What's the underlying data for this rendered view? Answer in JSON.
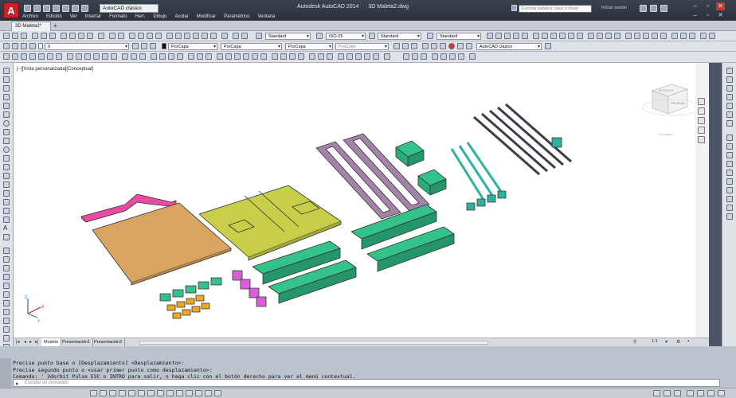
{
  "app": {
    "title": "Autodesk AutoCAD 2014",
    "document": "3D Maleta2.dwg",
    "logo": "A",
    "workspace": "AutoCAD clásico"
  },
  "search": {
    "placeholder": "Escriba palabra clave o frase"
  },
  "login": {
    "label": "Iniciar sesión"
  },
  "menu": [
    "Archivo",
    "Edición",
    "Ver",
    "Insertar",
    "Formato",
    "Herr.",
    "Dibujo",
    "Acotar",
    "Modificar",
    "Paramétrico",
    "Ventana"
  ],
  "tabs": {
    "document_tab": "3D Maleta2*"
  },
  "toolbar1": {
    "text_style": "Standard",
    "dim_style": "ISO-25",
    "table_style": "Standard",
    "mleader_style": "Standard"
  },
  "toolbar2": {
    "layer": "0",
    "color": "PorCapa",
    "linetype": "PorCapa",
    "lineweight": "PorCapa",
    "plotstyle": "PorColor",
    "workspace": "AutoCAD clásico"
  },
  "viewport": {
    "label": "[−][Vista personalizada][Conceptual]",
    "viewcube_face": "FRONTAL",
    "viewcube_top": "SUPERIOR",
    "wcs_label": "S-nombre"
  },
  "layout_tabs": [
    "Modelo",
    "Presentación1",
    "Presentación2"
  ],
  "command": {
    "history": [
      "Precise punto base o [Desplazamiento] <Desplazamiento>:",
      "Precise segundo punto o <usar primer punto como desplazamiento>:",
      "Comando: '_3dorbit Pulse ESC o INTRO para salir, o haga clic con el botón derecho para ver el menú contextual."
    ],
    "input_placeholder": "Escriba un comando"
  },
  "annotation_scale": "1:1",
  "colors": {
    "brand": "#c8202a",
    "part_pink": "#ec4aa2",
    "part_orange": "#d9a461",
    "part_yellow": "#c8ce48",
    "part_purple": "#a384a8",
    "part_green": "#33c28a",
    "part_teal": "#2eb2a0",
    "part_magenta": "#d85fd8",
    "part_amber": "#f0a821",
    "part_dark": "#3a3f46"
  }
}
